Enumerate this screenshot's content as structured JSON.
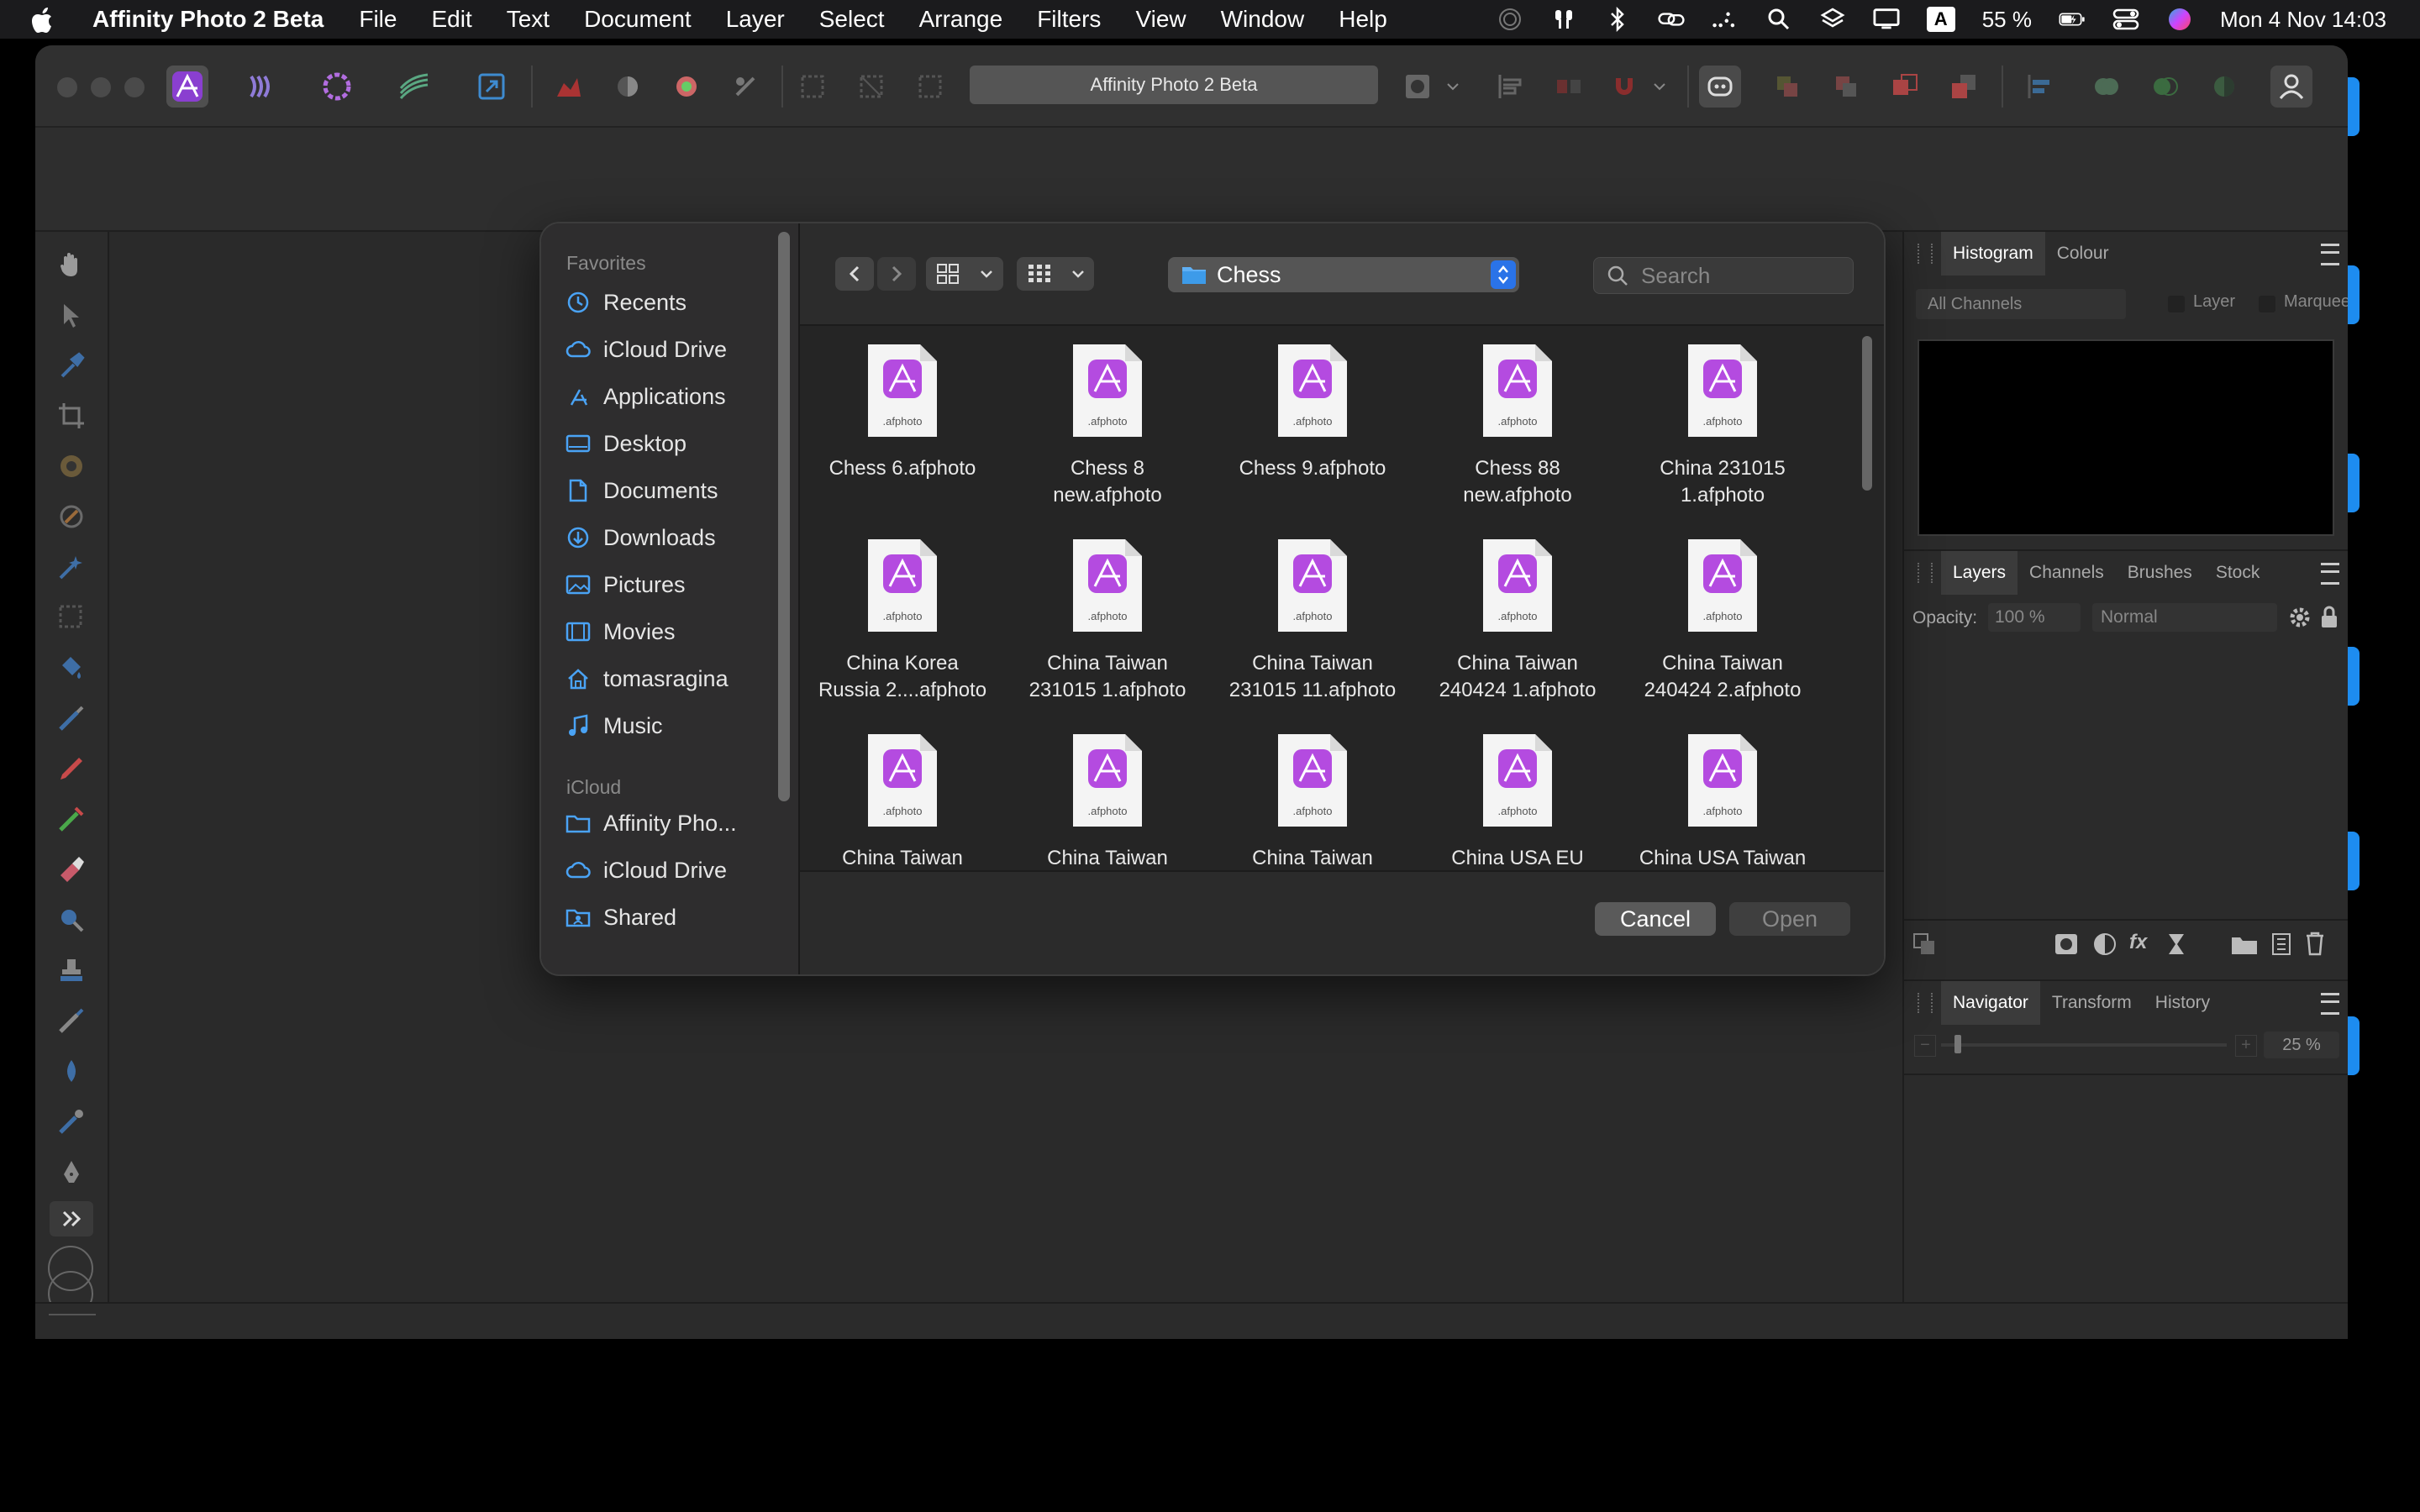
{
  "menubar": {
    "app_name": "Affinity Photo 2 Beta",
    "menus": [
      "File",
      "Edit",
      "Text",
      "Document",
      "Layer",
      "Select",
      "Arrange",
      "Filters",
      "View",
      "Window",
      "Help"
    ],
    "battery": "55 %",
    "input_source": "A",
    "datetime": "Mon 4 Nov  14:03"
  },
  "toolbar": {
    "document_title": "Affinity Photo 2 Beta"
  },
  "panels": {
    "histogram_tabs": [
      "Histogram",
      "Colour"
    ],
    "channels_select": "All Channels",
    "layer_checkbox": "Layer",
    "marquee_checkbox": "Marquee",
    "layers_tabs": [
      "Layers",
      "Channels",
      "Brushes",
      "Stock"
    ],
    "opacity_label": "Opacity:",
    "opacity_value": "100 %",
    "blend_mode": "Normal",
    "navigator_tabs": [
      "Navigator",
      "Transform",
      "History"
    ],
    "zoom_value": "25 %"
  },
  "dialog": {
    "sidebar": {
      "favorites_heading": "Favorites",
      "favorites": [
        {
          "label": "Recents",
          "icon": "clock-icon"
        },
        {
          "label": "iCloud Drive",
          "icon": "cloud-icon"
        },
        {
          "label": "Applications",
          "icon": "applications-icon"
        },
        {
          "label": "Desktop",
          "icon": "desktop-icon"
        },
        {
          "label": "Documents",
          "icon": "document-icon"
        },
        {
          "label": "Downloads",
          "icon": "download-icon"
        },
        {
          "label": "Pictures",
          "icon": "pictures-icon"
        },
        {
          "label": "Movies",
          "icon": "film-icon"
        },
        {
          "label": "tomasragina",
          "icon": "home-icon"
        },
        {
          "label": "Music",
          "icon": "music-icon"
        }
      ],
      "icloud_heading": "iCloud",
      "icloud": [
        {
          "label": "Affinity Pho...",
          "icon": "folder-icon"
        },
        {
          "label": "iCloud Drive",
          "icon": "cloud-icon"
        },
        {
          "label": "Shared",
          "icon": "shared-folder-icon"
        }
      ]
    },
    "current_folder": "Chess",
    "search_placeholder": "Search",
    "file_ext_badge": ".afphoto",
    "files": [
      [
        "Chess 6.afphoto"
      ],
      [
        "Chess 8",
        "new.afphoto"
      ],
      [
        "Chess 9.afphoto"
      ],
      [
        "Chess 88",
        "new.afphoto"
      ],
      [
        "China 231015",
        "1.afphoto"
      ],
      [
        "China Korea",
        "Russia 2....afphoto"
      ],
      [
        "China Taiwan",
        "231015 1.afphoto"
      ],
      [
        "China Taiwan",
        "231015 11.afphoto"
      ],
      [
        "China Taiwan",
        "240424 1.afphoto"
      ],
      [
        "China Taiwan",
        "240424 2.afphoto"
      ],
      [
        "China Taiwan"
      ],
      [
        "China Taiwan"
      ],
      [
        "China Taiwan"
      ],
      [
        "China USA EU"
      ],
      [
        "China USA Taiwan"
      ]
    ],
    "cancel_label": "Cancel",
    "open_label": "Open"
  },
  "colors": {
    "accent_blue": "#2a73e8",
    "afphoto_purple": "#b44be0"
  }
}
